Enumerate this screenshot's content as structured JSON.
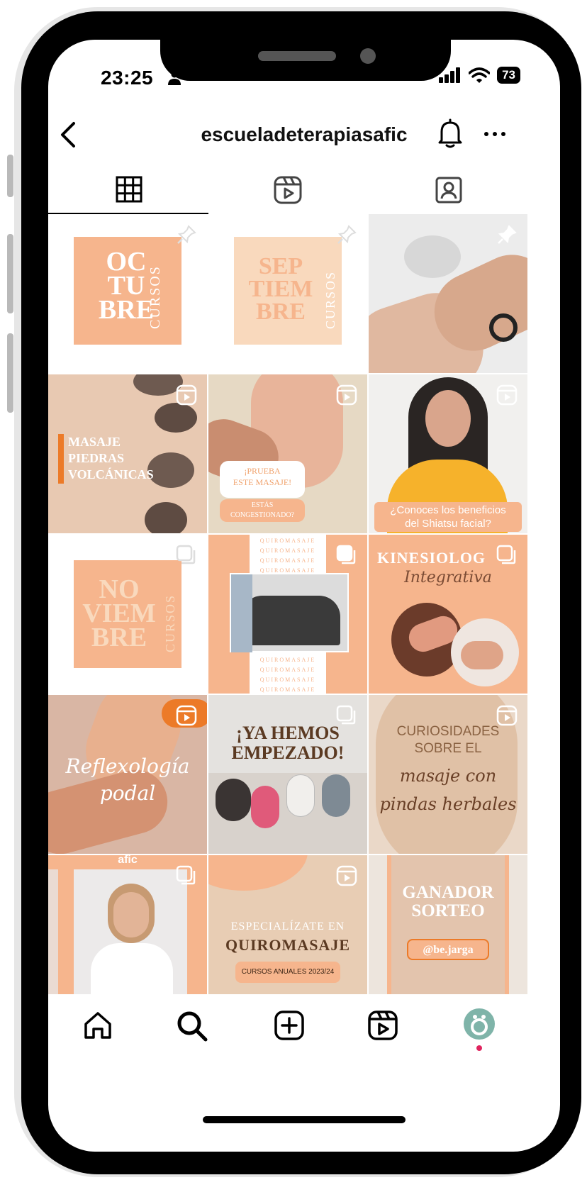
{
  "status": {
    "time": "23:25",
    "battery": "73"
  },
  "profile": {
    "username": "escueladeterapiasafic"
  },
  "tabs": [
    {
      "name": "posts",
      "icon": "grid-icon",
      "active": true
    },
    {
      "name": "reels",
      "icon": "reels-icon",
      "active": false
    },
    {
      "name": "tagged",
      "icon": "tagged-person-icon",
      "active": false
    }
  ],
  "posts": {
    "p1": {
      "lines": [
        "OC",
        "TU",
        "BRE"
      ],
      "side": "CURSOS"
    },
    "p2": {
      "lines": [
        "SEP",
        "TIEM",
        "BRE"
      ],
      "side": "CURSOS"
    },
    "p4": {
      "lines": [
        "MASAJE",
        "PIEDRAS",
        "VOLCÁNICAS"
      ]
    },
    "p5": {
      "bubble_1": "¡PRUEBA",
      "bubble_2": "ESTE MASAJE!",
      "question": "ESTÁS",
      "question_2": "CONGESTIONADO?"
    },
    "p6": {
      "caption_1": "¿Conoces los beneficios",
      "caption_2": "del Shiatsu facial?"
    },
    "p7": {
      "lines": [
        "NO",
        "VIEM",
        "BRE"
      ],
      "side": "CURSOS"
    },
    "p8": {
      "repeat": "QUIROMASAJE"
    },
    "p9": {
      "title": "KINESIOLOG",
      "subtitle": "Integrativa"
    },
    "p10": {
      "line_1": "Reflexología",
      "line_2": "podal"
    },
    "p11": {
      "line_1": "¡YA HEMOS",
      "line_2": "EMPEZADO!"
    },
    "p12": {
      "line_1": "CURIOSIDADES",
      "line_2": "SOBRE EL",
      "line_3": "masaje con",
      "line_4": "pindas herbales"
    },
    "p13": {
      "brand": "afic"
    },
    "p14": {
      "line_1": "ESPECIALÍZATE EN",
      "line_2": "QUIROMASAJE",
      "pill": "CURSOS ANUALES 2023/24"
    },
    "p15": {
      "line_1": "GANADOR",
      "line_2": "SORTEO",
      "handle": "@be.jarga"
    }
  },
  "bottom_nav": [
    "home-icon",
    "search-icon",
    "create-icon",
    "reels-icon",
    "profile-avatar"
  ],
  "colors": {
    "peach": "#f6b58d",
    "light_peach": "#f9d9bd",
    "accent_orange": "#ec7a28",
    "notification_dot": "#e0245e"
  }
}
